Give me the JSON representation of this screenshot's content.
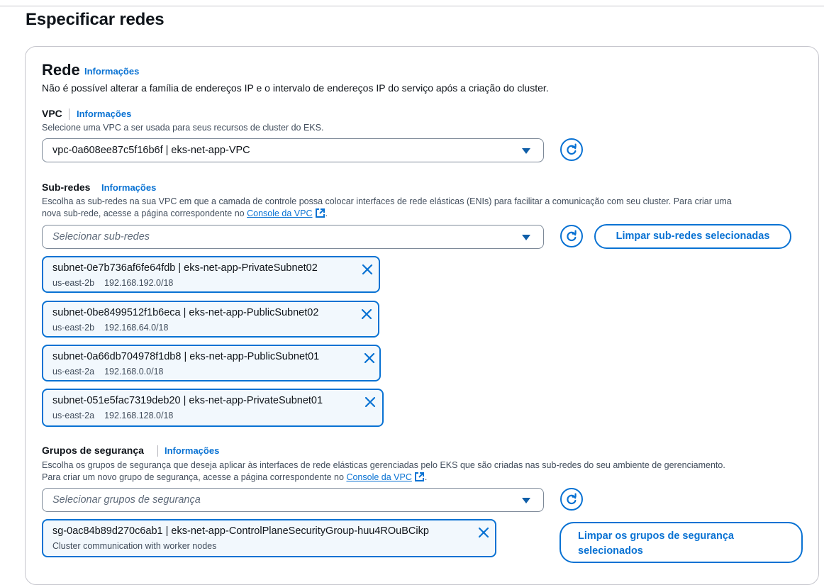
{
  "page": {
    "title": "Especificar redes"
  },
  "network": {
    "heading": "Rede",
    "info": "Informações",
    "description": "Não é possível alterar a família de endereços IP e o intervalo de endereços IP do serviço após a criação do cluster."
  },
  "vpc": {
    "label": "VPC",
    "info": "Informações",
    "hint": "Selecione uma VPC a ser usada para seus recursos de cluster do EKS.",
    "selected": "vpc-0a608ee87c5f16b6f | eks-net-app-VPC"
  },
  "subnets": {
    "label": "Sub-redes",
    "info": "Informações",
    "hint_line1": "Escolha as sub-redes na sua VPC em que a camada de controle possa colocar interfaces de rede elásticas (ENIs) para facilitar a comunicação com seu cluster. Para criar uma",
    "hint_line2_prefix": "nova sub-rede, acesse a página correspondente no ",
    "console_link": "Console da VPC",
    "hint_line2_suffix": ".",
    "placeholder": "Selecionar sub-redes",
    "clear_button": "Limpar sub-redes selecionadas",
    "tokens": [
      {
        "name": "subnet-0e7b736af6fe64fdb | eks-net-app-PrivateSubnet02",
        "az": "us-east-2b",
        "cidr": "192.168.192.0/18"
      },
      {
        "name": "subnet-0be8499512f1b6eca | eks-net-app-PublicSubnet02",
        "az": "us-east-2b",
        "cidr": "192.168.64.0/18"
      },
      {
        "name": "subnet-0a66db704978f1db8 | eks-net-app-PublicSubnet01",
        "az": "us-east-2a",
        "cidr": "192.168.0.0/18"
      },
      {
        "name": "subnet-051e5fac7319deb20 | eks-net-app-PrivateSubnet01",
        "az": "us-east-2a",
        "cidr": "192.168.128.0/18"
      }
    ]
  },
  "security_groups": {
    "label": "Grupos de segurança",
    "info": "Informações",
    "hint_line1": "Escolha os grupos de segurança que deseja aplicar às interfaces de rede elásticas gerenciadas pelo EKS que são criadas nas sub-redes do seu ambiente de gerenciamento.",
    "hint_line2_prefix": "Para criar um novo grupo de segurança, acesse a página correspondente no ",
    "console_link": "Console da VPC",
    "hint_line2_suffix": ".",
    "placeholder": "Selecionar grupos de segurança",
    "clear_button_line1": "Limpar os grupos de segurança",
    "clear_button_line2": "selecionados",
    "tokens": [
      {
        "name": "sg-0ac84b89d270c6ab1 | eks-net-app-ControlPlaneSecurityGroup-huu4ROuBCikp",
        "description": "Cluster communication with worker nodes"
      }
    ]
  },
  "colors": {
    "accent": "#0972d3",
    "token_bg": "#f2f8fd",
    "border": "#7d8998"
  },
  "icons": [
    "caret-down-icon",
    "refresh-icon",
    "close-icon",
    "external-link-icon"
  ]
}
